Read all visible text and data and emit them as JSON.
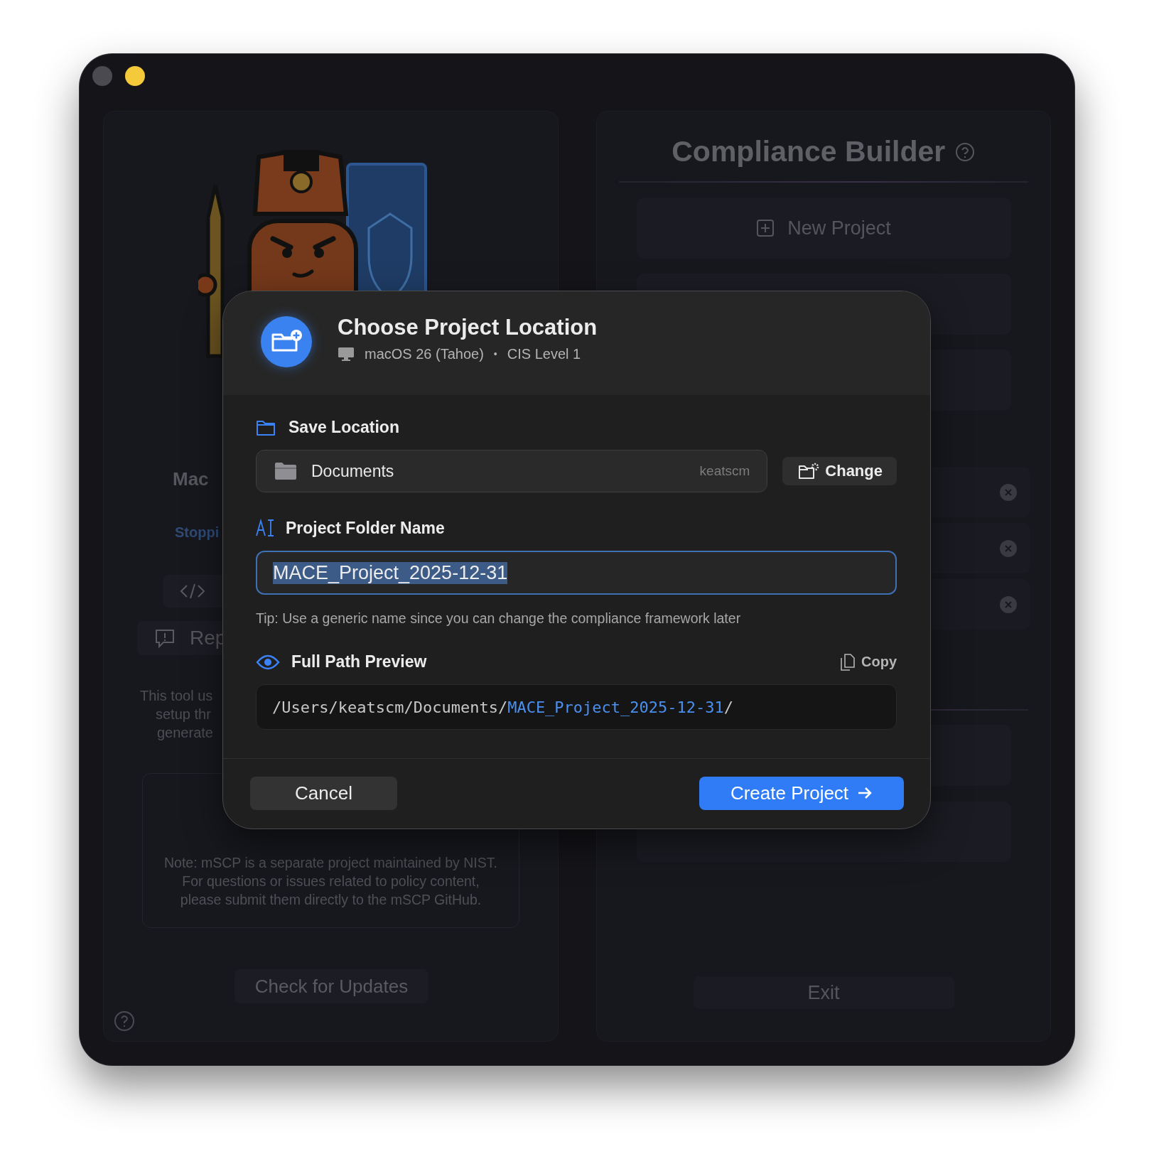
{
  "window": {
    "traffic_lights": [
      {
        "color": "#4a4a50"
      },
      {
        "color": "#f4c93a"
      }
    ]
  },
  "left_panel": {
    "heading": "Mac",
    "link": "Stoppi",
    "report_button": "Rep",
    "description_lines": [
      "This tool us",
      "setup thr",
      "generate"
    ],
    "note": "Note: mSCP is a separate project maintained by NIST. For questions or issues related to policy content, please submit them directly to the mSCP GitHub.",
    "update_button": "Check for Updates"
  },
  "right_panel": {
    "title": "Compliance Builder",
    "new_project_button": "New Project",
    "exit_button": "Exit"
  },
  "dialog": {
    "title": "Choose Project Location",
    "platform": "macOS 26 (Tahoe)",
    "separator": "•",
    "benchmark": "CIS Level 1",
    "save_location": {
      "label": "Save Location",
      "folder": "Documents",
      "user": "keatscm",
      "change_button": "Change"
    },
    "folder_name": {
      "label": "Project Folder Name",
      "value": "MACE_Project_2025-12-31",
      "focused": true,
      "text_selected": true
    },
    "tip": "Tip: Use a generic name since you can change the compliance framework later",
    "preview": {
      "label": "Full Path Preview",
      "copy_button": "Copy",
      "path_prefix": "/Users/keatscm/Documents/",
      "path_name": "MACE_Project_2025-12-31",
      "path_suffix": "/"
    },
    "cancel_button": "Cancel",
    "create_button": "Create Project"
  }
}
